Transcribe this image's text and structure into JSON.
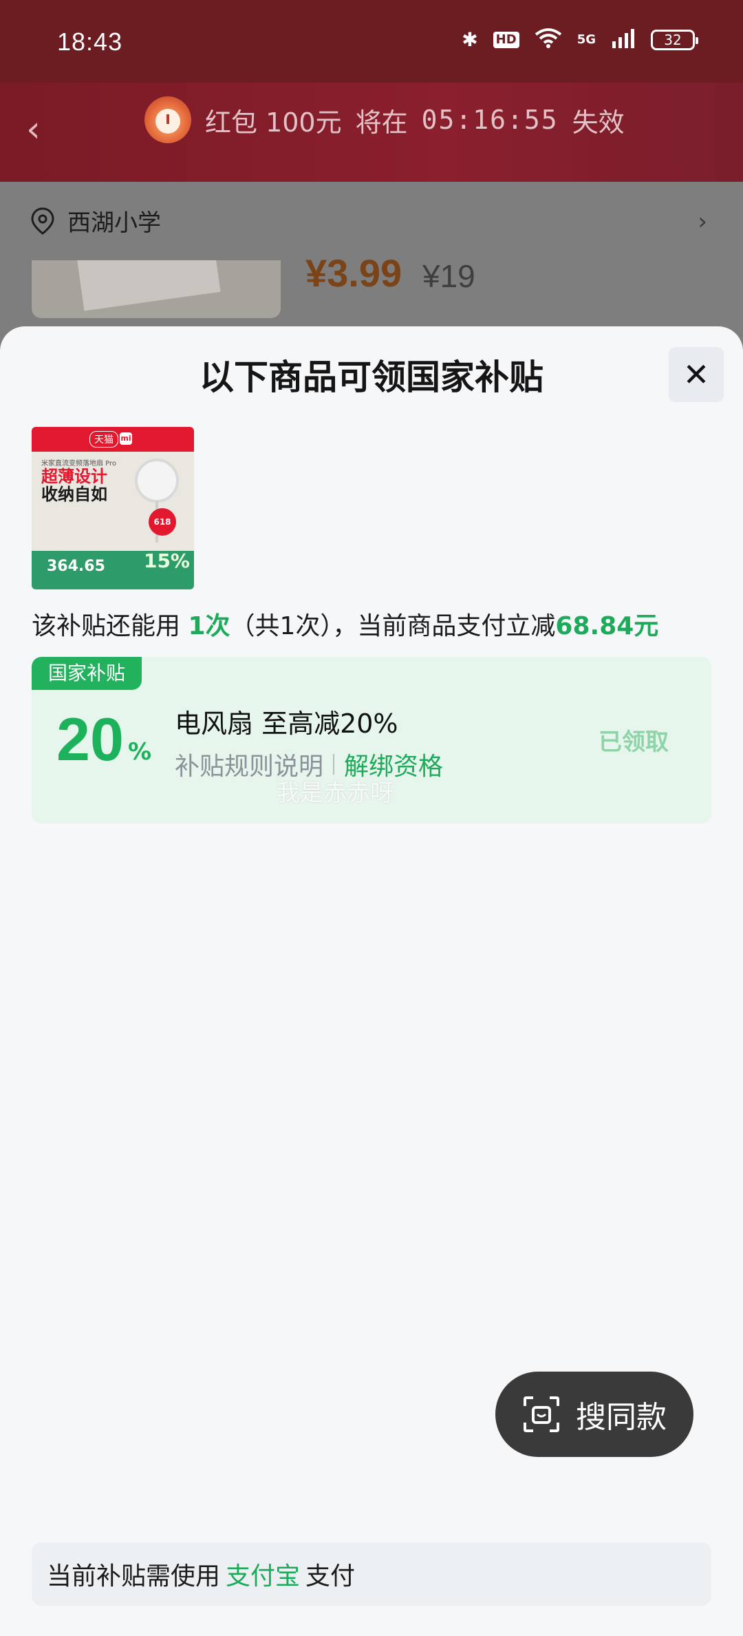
{
  "status_bar": {
    "time": "18:43",
    "hd": "HD",
    "signal": "5G",
    "battery": "32"
  },
  "header": {
    "red_packet_text": "红包 100元",
    "expire_prefix": "将在",
    "countdown": "05:16:55",
    "expire_suffix": "失效"
  },
  "background": {
    "location": "西湖小学",
    "price_now": "¥3.99",
    "price_old": "¥19"
  },
  "sheet": {
    "title": "以下商品可领国家补贴",
    "close": "✕",
    "product_image": {
      "store": "天猫",
      "brand": "mi",
      "subtitle": "米家直流变频落地扇 Pro",
      "headline1": "超薄设计",
      "headline2": "收纳自如",
      "price": "364.65",
      "badge": "618",
      "percent": "15%"
    },
    "usage": {
      "prefix": "该补贴还能用 ",
      "count": "1次",
      "mid": "（共1次），当前商品支付立减",
      "amount": "68.84元"
    },
    "card": {
      "tag": "国家补贴",
      "percent": "20",
      "percent_symbol": "%",
      "title": "电风扇 至高减20%",
      "rules_link": "补贴规则说明",
      "unbind_link": "解绑资格",
      "status": "已领取",
      "watermark": "我是赤赤呀"
    },
    "search_same": "搜同款",
    "pay": {
      "prefix": "当前补贴需使用",
      "method": "支付宝",
      "suffix": "支付"
    }
  },
  "colors": {
    "accent_green": "#1daa5a",
    "tag_green": "#22b25e",
    "card_bg": "#e6f6ec",
    "red_bar": "#8a1f2d"
  }
}
